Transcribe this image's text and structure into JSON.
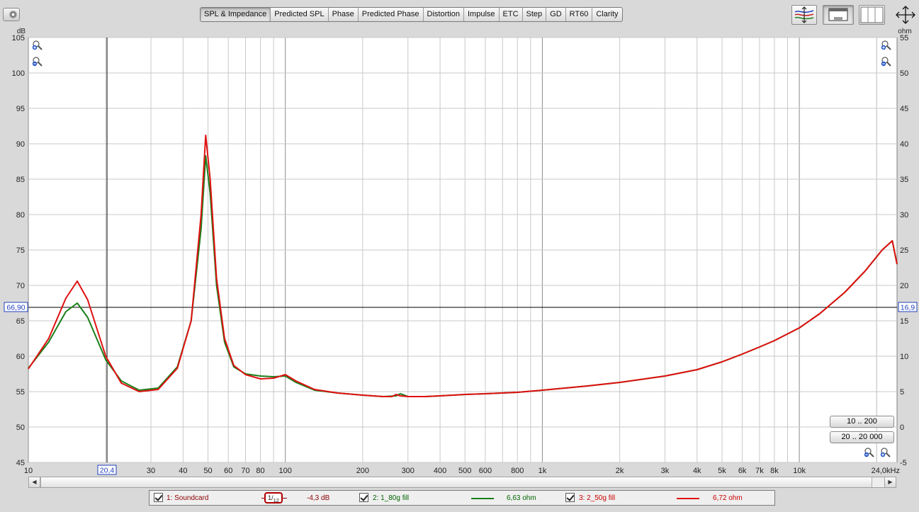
{
  "tabs": [
    "SPL & Impedance",
    "Predicted SPL",
    "Phase",
    "Predicted Phase",
    "Distortion",
    "Impulse",
    "ETC",
    "Step",
    "GD",
    "RT60",
    "Clarity"
  ],
  "active_tab": "SPL & Impedance",
  "view_buttons": [
    "traces-arrange-icon",
    "window-layout-icon",
    "grid-layout-icon",
    "move-arrows-icon"
  ],
  "axes": {
    "left_unit": "dB",
    "right_unit": "ohm",
    "left_ticks": [
      "105",
      "100",
      "95",
      "90",
      "85",
      "80",
      "75",
      "70",
      "65",
      "60",
      "55",
      "50",
      "45"
    ],
    "right_ticks": [
      "55",
      "50",
      "45",
      "40",
      "35",
      "30",
      "25",
      "20",
      "15",
      "10",
      "5",
      "0",
      "-5"
    ],
    "x_ticks": [
      "10",
      "30",
      "40",
      "50",
      "60",
      "70",
      "80",
      "100",
      "200",
      "300",
      "400",
      "500",
      "600",
      "800",
      "1k",
      "2k",
      "3k",
      "4k",
      "5k",
      "6k",
      "7k",
      "8k",
      "10k",
      "24,0kHz"
    ]
  },
  "cursor": {
    "x_label": "20,4",
    "y_left_label": "66,90",
    "y_right_label": "16,9"
  },
  "range_buttons": [
    "10 .. 200",
    "20 .. 20 000"
  ],
  "legend": {
    "trace1_label": "1: Soundcard",
    "smoothing_num": "1",
    "smoothing_den": "12",
    "trace1_value": "-4,3 dB",
    "trace2_label": "2: 1_80g fill",
    "trace2_value": "6,63 ohm",
    "trace3_label": "3: 2_50g fill",
    "trace3_value": "6,72 ohm"
  },
  "colors": {
    "plot_bg": "#ffffff",
    "grid": "#c9c9c9",
    "trace_green": "#1a7f1a",
    "trace_red": "#e01010",
    "cursor_label": "#1f3fbf"
  },
  "chart_data": {
    "type": "line",
    "x_scale": "log",
    "xlim": [
      10,
      24000
    ],
    "ylim_left": [
      45,
      105
    ],
    "ylim_right": [
      -5,
      55
    ],
    "series": [
      {
        "name": "2: 1_80g fill",
        "color": "#1a7f1a",
        "x": [
          10,
          12,
          14,
          15.5,
          17,
          20,
          23,
          27,
          32,
          38,
          43,
          47,
          49,
          51,
          54,
          58,
          63,
          70,
          80,
          90,
          100,
          110,
          130,
          160,
          200,
          240,
          270,
          280,
          290,
          300,
          350,
          400,
          500,
          600,
          800,
          1000,
          1500,
          2000,
          3000,
          4000,
          5000,
          6000,
          7000,
          8000,
          10000,
          12000,
          15000,
          18000,
          21000,
          23000,
          24000
        ],
        "y": [
          8.3,
          12.0,
          16.3,
          17.5,
          15.5,
          9.5,
          6.5,
          5.2,
          5.5,
          8.5,
          15.0,
          28.0,
          38.3,
          33.0,
          20.0,
          12.0,
          8.5,
          7.5,
          7.2,
          7.1,
          7.2,
          6.3,
          5.2,
          4.8,
          4.5,
          4.3,
          4.4,
          4.7,
          4.5,
          4.3,
          4.3,
          4.4,
          4.6,
          4.7,
          4.9,
          5.2,
          5.8,
          6.3,
          7.2,
          8.1,
          9.2,
          10.3,
          11.3,
          12.2,
          14.0,
          16.0,
          19.0,
          22.0,
          25.0,
          26.3,
          23.0
        ]
      },
      {
        "name": "3: 2_50g fill",
        "color": "#e01010",
        "x": [
          10,
          12,
          14,
          15.5,
          17,
          20,
          23,
          27,
          32,
          38,
          43,
          47,
          49,
          51,
          54,
          58,
          63,
          70,
          80,
          90,
          100,
          110,
          130,
          160,
          200,
          240,
          260,
          270,
          280,
          300,
          350,
          400,
          500,
          600,
          800,
          1000,
          1500,
          2000,
          3000,
          4000,
          5000,
          6000,
          7000,
          8000,
          10000,
          12000,
          15000,
          18000,
          21000,
          23000,
          24000
        ],
        "y": [
          8.2,
          12.5,
          18.2,
          20.6,
          18.0,
          10.0,
          6.2,
          5.0,
          5.3,
          8.3,
          15.0,
          30.0,
          41.2,
          35.0,
          21.0,
          12.5,
          8.7,
          7.4,
          6.8,
          6.9,
          7.4,
          6.5,
          5.3,
          4.8,
          4.5,
          4.3,
          4.3,
          4.6,
          4.4,
          4.3,
          4.3,
          4.4,
          4.6,
          4.7,
          4.9,
          5.2,
          5.8,
          6.3,
          7.2,
          8.1,
          9.2,
          10.3,
          11.3,
          12.2,
          14.0,
          16.0,
          19.0,
          22.0,
          25.0,
          26.3,
          23.0
        ]
      }
    ]
  }
}
